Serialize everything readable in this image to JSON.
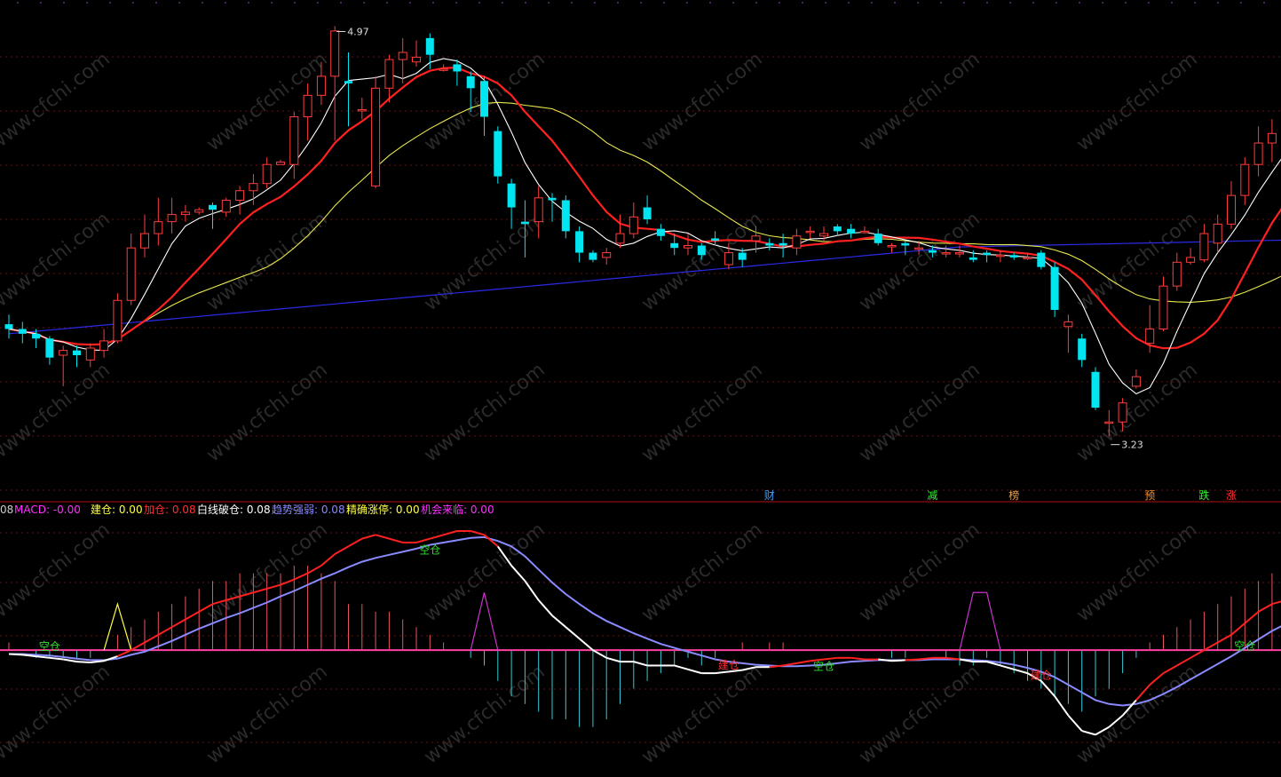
{
  "chart_data": [
    {
      "type": "candlestick",
      "panel": "price",
      "annotations": {
        "high_label": "4.97",
        "low_label": "3.23",
        "high_value": 4.97,
        "low_value": 3.23
      },
      "ylim": [
        3.05,
        5.05
      ],
      "grid": "dotted horizontal",
      "colors": {
        "up": "#ff3d3d",
        "down": "#00e5f0",
        "ma_fast": "#ffffff",
        "ma_mid": "#ff2020",
        "ma_slow": "#e8e850",
        "ma_long": "#2a2ae8"
      },
      "candles": [
        [
          3.72,
          3.7,
          3.76,
          3.66
        ],
        [
          3.7,
          3.68,
          3.73,
          3.64
        ],
        [
          3.68,
          3.66,
          3.7,
          3.62
        ],
        [
          3.66,
          3.58,
          3.67,
          3.55
        ],
        [
          3.59,
          3.61,
          3.63,
          3.46
        ],
        [
          3.61,
          3.59,
          3.63,
          3.54
        ],
        [
          3.57,
          3.62,
          3.64,
          3.54
        ],
        [
          3.61,
          3.65,
          3.7,
          3.58
        ],
        [
          3.65,
          3.82,
          3.85,
          3.64
        ],
        [
          3.82,
          4.04,
          4.1,
          3.8
        ],
        [
          4.04,
          4.1,
          4.18,
          4.0
        ],
        [
          4.1,
          4.15,
          4.25,
          4.05
        ],
        [
          4.15,
          4.18,
          4.25,
          4.1
        ],
        [
          4.18,
          4.19,
          4.22,
          4.15
        ],
        [
          4.19,
          4.2,
          4.21,
          4.18
        ],
        [
          4.22,
          4.2,
          4.23,
          4.12
        ],
        [
          4.19,
          4.24,
          4.25,
          4.17
        ],
        [
          4.24,
          4.28,
          4.3,
          4.18
        ],
        [
          4.28,
          4.31,
          4.35,
          4.22
        ],
        [
          4.31,
          4.39,
          4.42,
          4.29
        ],
        [
          4.39,
          4.4,
          4.41,
          4.39
        ],
        [
          4.39,
          4.59,
          4.61,
          4.33
        ],
        [
          4.59,
          4.68,
          4.73,
          4.49
        ],
        [
          4.68,
          4.76,
          4.82,
          4.64
        ],
        [
          4.76,
          4.95,
          4.97,
          4.49
        ],
        [
          4.74,
          4.73,
          4.86,
          4.55
        ],
        [
          4.62,
          4.62,
          4.67,
          4.58
        ],
        [
          4.3,
          4.71,
          4.76,
          4.29
        ],
        [
          4.71,
          4.83,
          4.85,
          4.65
        ],
        [
          4.83,
          4.86,
          4.92,
          4.73
        ],
        [
          4.82,
          4.84,
          4.91,
          4.8
        ],
        [
          4.92,
          4.85,
          4.94,
          4.79
        ],
        [
          4.79,
          4.79,
          4.81,
          4.78
        ],
        [
          4.81,
          4.78,
          4.83,
          4.72
        ],
        [
          4.76,
          4.71,
          4.78,
          4.61
        ],
        [
          4.74,
          4.59,
          4.76,
          4.51
        ],
        [
          4.53,
          4.34,
          4.55,
          4.31
        ],
        [
          4.31,
          4.21,
          4.33,
          4.12
        ],
        [
          4.15,
          4.14,
          4.24,
          4.0
        ],
        [
          4.15,
          4.25,
          4.3,
          4.08
        ],
        [
          4.25,
          4.24,
          4.27,
          4.15
        ],
        [
          4.24,
          4.11,
          4.26,
          4.08
        ],
        [
          4.11,
          4.02,
          4.13,
          3.98
        ],
        [
          4.02,
          3.99,
          4.03,
          3.98
        ],
        [
          4.0,
          4.02,
          4.04,
          3.97
        ],
        [
          4.06,
          4.1,
          4.18,
          4.04
        ],
        [
          4.1,
          4.17,
          4.23,
          4.08
        ],
        [
          4.21,
          4.16,
          4.26,
          4.14
        ],
        [
          4.12,
          4.09,
          4.14,
          4.07
        ],
        [
          4.06,
          4.04,
          4.1,
          4.01
        ],
        [
          4.04,
          4.05,
          4.1,
          4.01
        ],
        [
          4.05,
          4.01,
          4.06,
          3.99
        ],
        [
          4.08,
          4.07,
          4.11,
          4.05
        ],
        [
          3.97,
          4.02,
          4.06,
          3.95
        ],
        [
          4.02,
          3.99,
          4.04,
          3.96
        ],
        [
          4.07,
          4.09,
          4.13,
          4.02
        ],
        [
          4.06,
          4.05,
          4.08,
          4.03
        ],
        [
          4.06,
          4.05,
          4.1,
          4.0
        ],
        [
          4.04,
          4.09,
          4.12,
          4.01
        ],
        [
          4.11,
          4.11,
          4.13,
          4.08
        ],
        [
          4.09,
          4.1,
          4.13,
          4.07
        ],
        [
          4.13,
          4.11,
          4.14,
          4.09
        ],
        [
          4.12,
          4.1,
          4.14,
          4.08
        ],
        [
          4.11,
          4.11,
          4.13,
          4.1
        ],
        [
          4.1,
          4.06,
          4.12,
          4.05
        ],
        [
          4.05,
          4.05,
          4.06,
          4.02
        ],
        [
          4.06,
          4.05,
          4.07,
          4.01
        ],
        [
          4.04,
          4.04,
          4.07,
          4.01
        ],
        [
          4.03,
          4.02,
          4.05,
          4.0
        ],
        [
          4.02,
          4.02,
          4.05,
          4.0
        ],
        [
          4.02,
          4.02,
          4.05,
          4.0
        ],
        [
          4.0,
          3.99,
          4.03,
          3.98
        ],
        [
          4.02,
          4.01,
          4.03,
          3.98
        ],
        [
          4.01,
          4.01,
          4.03,
          3.98
        ],
        [
          4.01,
          4.0,
          4.02,
          3.99
        ],
        [
          4.0,
          4.0,
          4.02,
          3.99
        ],
        [
          4.02,
          3.96,
          4.03,
          3.95
        ],
        [
          3.96,
          3.78,
          3.98,
          3.75
        ],
        [
          3.71,
          3.73,
          3.76,
          3.6
        ],
        [
          3.66,
          3.57,
          3.68,
          3.54
        ],
        [
          3.52,
          3.37,
          3.54,
          3.36
        ],
        [
          3.31,
          3.31,
          3.36,
          3.25
        ],
        [
          3.31,
          3.39,
          3.41,
          3.27
        ],
        [
          3.46,
          3.5,
          3.53,
          3.45
        ],
        [
          3.64,
          3.7,
          3.8,
          3.6
        ],
        [
          3.7,
          3.88,
          3.92,
          3.69
        ],
        [
          3.88,
          3.98,
          4.02,
          3.86
        ],
        [
          3.98,
          4.0,
          4.04,
          3.97
        ],
        [
          3.99,
          4.1,
          4.14,
          3.98
        ],
        [
          4.06,
          4.14,
          4.18,
          4.02
        ],
        [
          4.14,
          4.26,
          4.32,
          4.12
        ],
        [
          4.26,
          4.39,
          4.42,
          4.22
        ],
        [
          4.39,
          4.48,
          4.55,
          4.34
        ],
        [
          4.48,
          4.52,
          4.58,
          4.4
        ],
        [
          4.52,
          4.54,
          4.6,
          4.47
        ],
        [
          4.56,
          4.45,
          4.61,
          4.42
        ],
        [
          4.45,
          4.47,
          4.55,
          4.44
        ],
        [
          4.48,
          4.51,
          4.58,
          4.39
        ],
        [
          4.5,
          4.55,
          4.63,
          4.43
        ],
        [
          4.53,
          4.59,
          4.74,
          4.47
        ],
        [
          4.56,
          4.31,
          4.57,
          4.28
        ],
        [
          4.18,
          4.12,
          4.2,
          4.05
        ],
        [
          4.1,
          4.06,
          4.13,
          3.9
        ],
        [
          4.04,
          4.26,
          4.31,
          4.02
        ],
        [
          4.21,
          4.4,
          4.49,
          4.17
        ]
      ],
      "ma_fast_label": "MA5",
      "ma_mid_label": "MA10",
      "ma_slow_label": "MA20",
      "ma_long_label": "MA60",
      "signal_tags": [
        {
          "label": "财",
          "color": "#3aa0ff"
        },
        {
          "label": "减",
          "color": "#33ee33"
        },
        {
          "label": "榜",
          "color": "#e8a050"
        },
        {
          "label": "预",
          "color": "#ff8c20"
        },
        {
          "label": "跌",
          "color": "#33ee33"
        },
        {
          "label": "涨",
          "color": "#ff3030"
        }
      ]
    },
    {
      "type": "indicator",
      "panel": "macd",
      "header": [
        {
          "text": "08",
          "color": "#cccccc"
        },
        {
          "text": "MACD: -0.00",
          "color": "#ff30ff"
        },
        {
          "text": "建仓: 0.00",
          "color": "#ffff40"
        },
        {
          "text": "加仓: 0.08",
          "color": "#ff3030"
        },
        {
          "text": "白线破仓: 0.08",
          "color": "#ffffff"
        },
        {
          "text": "趋势强弱: 0.08",
          "color": "#8888ff"
        },
        {
          "text": "精确涨停: 0.00",
          "color": "#ffff40"
        },
        {
          "text": "机会来临: 0.00",
          "color": "#ff30ff"
        }
      ],
      "ylim": [
        -0.15,
        0.17
      ],
      "zero": 0,
      "histogram": [
        0.01,
        0.0,
        -0.01,
        -0.01,
        -0.01,
        -0.01,
        -0.01,
        0.0,
        0.02,
        0.03,
        0.04,
        0.05,
        0.06,
        0.07,
        0.08,
        0.09,
        0.09,
        0.1,
        0.1,
        0.1,
        0.1,
        0.11,
        0.11,
        0.1,
        0.09,
        0.06,
        0.06,
        0.05,
        0.05,
        0.04,
        0.03,
        0.02,
        0.01,
        0.0,
        -0.01,
        -0.02,
        -0.04,
        -0.06,
        -0.07,
        -0.08,
        -0.09,
        -0.09,
        -0.1,
        -0.1,
        -0.09,
        -0.07,
        -0.05,
        -0.04,
        -0.03,
        -0.02,
        -0.01,
        -0.02,
        -0.01,
        0.0,
        0.01,
        0.0,
        0.01,
        0.01,
        0.0,
        0.0,
        0.0,
        0.0,
        0.0,
        0.0,
        0.0,
        -0.01,
        -0.01,
        0.0,
        0.0,
        -0.01,
        -0.02,
        -0.02,
        -0.01,
        -0.02,
        -0.03,
        -0.04,
        -0.05,
        -0.06,
        -0.07,
        -0.08,
        -0.06,
        -0.05,
        -0.03,
        -0.01,
        0.01,
        0.02,
        0.03,
        0.04,
        0.05,
        0.06,
        0.07,
        0.08,
        0.09,
        0.1,
        0.09,
        0.08,
        0.08,
        0.07,
        0.06,
        0.04,
        0.01,
        0.0,
        0.0,
        0.0,
        0.0
      ],
      "dif": [
        -0.005,
        -0.006,
        -0.008,
        -0.01,
        -0.012,
        -0.015,
        -0.016,
        -0.014,
        -0.008,
        0.0,
        0.01,
        0.02,
        0.03,
        0.04,
        0.05,
        0.06,
        0.065,
        0.07,
        0.075,
        0.08,
        0.085,
        0.092,
        0.1,
        0.11,
        0.125,
        0.135,
        0.145,
        0.15,
        0.145,
        0.14,
        0.14,
        0.145,
        0.15,
        0.155,
        0.155,
        0.15,
        0.135,
        0.11,
        0.09,
        0.065,
        0.045,
        0.03,
        0.015,
        0.0,
        -0.01,
        -0.015,
        -0.015,
        -0.02,
        -0.02,
        -0.02,
        -0.025,
        -0.03,
        -0.03,
        -0.028,
        -0.026,
        -0.022,
        -0.022,
        -0.02,
        -0.017,
        -0.014,
        -0.012,
        -0.01,
        -0.01,
        -0.012,
        -0.012,
        -0.014,
        -0.013,
        -0.012,
        -0.01,
        -0.01,
        -0.012,
        -0.015,
        -0.015,
        -0.02,
        -0.025,
        -0.03,
        -0.04,
        -0.06,
        -0.085,
        -0.105,
        -0.11,
        -0.1,
        -0.085,
        -0.065,
        -0.045,
        -0.03,
        -0.02,
        -0.01,
        0.0,
        0.01,
        0.02,
        0.035,
        0.05,
        0.06,
        0.065,
        0.07,
        0.075,
        0.08,
        0.07,
        0.06,
        0.05,
        0.042,
        0.04,
        0.04,
        0.038
      ],
      "dea": [
        -0.005,
        -0.005,
        -0.006,
        -0.007,
        -0.009,
        -0.011,
        -0.013,
        -0.013,
        -0.011,
        -0.006,
        -0.002,
        0.005,
        0.012,
        0.02,
        0.028,
        0.035,
        0.042,
        0.048,
        0.055,
        0.062,
        0.07,
        0.077,
        0.085,
        0.093,
        0.1,
        0.108,
        0.115,
        0.12,
        0.124,
        0.128,
        0.132,
        0.137,
        0.14,
        0.143,
        0.146,
        0.147,
        0.142,
        0.135,
        0.122,
        0.105,
        0.088,
        0.073,
        0.06,
        0.048,
        0.038,
        0.03,
        0.022,
        0.015,
        0.008,
        0.003,
        -0.002,
        -0.007,
        -0.012,
        -0.015,
        -0.017,
        -0.019,
        -0.02,
        -0.021,
        -0.021,
        -0.02,
        -0.019,
        -0.017,
        -0.015,
        -0.014,
        -0.013,
        -0.013,
        -0.013,
        -0.013,
        -0.012,
        -0.012,
        -0.012,
        -0.013,
        -0.014,
        -0.016,
        -0.019,
        -0.023,
        -0.028,
        -0.035,
        -0.045,
        -0.055,
        -0.065,
        -0.07,
        -0.072,
        -0.07,
        -0.065,
        -0.057,
        -0.048,
        -0.038,
        -0.028,
        -0.018,
        -0.008,
        0.003,
        0.014,
        0.025,
        0.034,
        0.042,
        0.048,
        0.052,
        0.055,
        0.055,
        0.053,
        0.049,
        0.045,
        0.042,
        0.04
      ],
      "histogram_up_color": "#e8545c",
      "histogram_down_color": "#36c8d4",
      "dif_color_above": "#ff2020",
      "dif_color_below": "#ffffff",
      "dea_color": "#8a8aff",
      "triangles": [
        {
          "color": "#ffff40",
          "height": 0.06
        },
        {
          "color": "#cc33cc",
          "height": 0.075
        },
        {
          "color": "#cc33cc",
          "height": 0.075
        },
        {
          "color": "#ffff40",
          "height": 0.06
        }
      ],
      "markers": [
        {
          "text": "空仓",
          "color": "#30e030"
        },
        {
          "text": "空仓",
          "color": "#30e030"
        },
        {
          "text": "建仓",
          "color": "#ff3030"
        },
        {
          "text": "空仓",
          "color": "#30e030"
        },
        {
          "text": "建仓",
          "color": "#ff3030"
        },
        {
          "text": "空仓",
          "color": "#30e030"
        }
      ]
    }
  ],
  "watermark": "www.cfchi.com"
}
